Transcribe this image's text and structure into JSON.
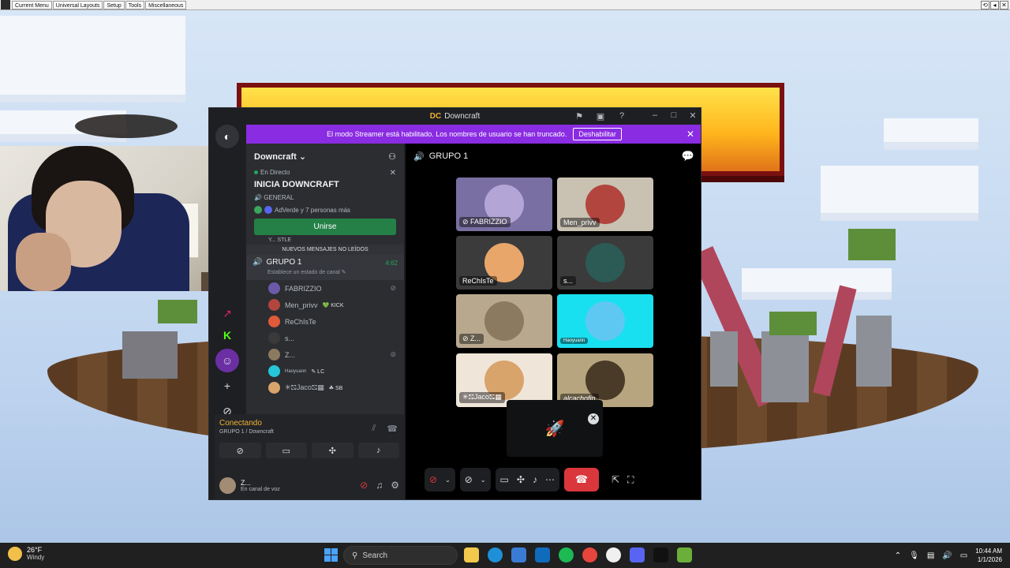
{
  "overlay_menu": {
    "items": [
      "Current Menu",
      "Universal Layouts",
      "Setup",
      "Tools",
      "Miscellaneous"
    ]
  },
  "discord": {
    "window_title": "Downcraft",
    "app_logo": "DC",
    "streamer_bar": {
      "message": "El modo Streamer está habilitado. Los nombres de usuario se han truncado.",
      "disable_label": "Deshabilitar"
    },
    "server_name": "Downcraft",
    "live": {
      "label": "En Directo",
      "title": "INICIA DOWNCRAFT",
      "channel": "GENERAL",
      "people": "AdVerde y 7 personas más",
      "join_label": "Unirse"
    },
    "partial_member": "Y... STLE",
    "new_messages_label": "NUEVOS MENSAJES NO LEÍDOS",
    "voice_channel": {
      "name": "GRUPO 1",
      "timer": "4:62",
      "status": "Establece un estado de canal"
    },
    "members": [
      {
        "name": "FABRIZZIO",
        "tag": "",
        "muted": true,
        "color": "#6c5aa8"
      },
      {
        "name": "Men_privv",
        "tag": "KICK",
        "muted": false,
        "color": "#b2463f"
      },
      {
        "name": "ReChIsTe",
        "tag": "",
        "muted": false,
        "color": "#e05a3a"
      },
      {
        "name": "s...",
        "tag": "",
        "muted": false,
        "color": "#3a3a3a"
      },
      {
        "name": "Z...",
        "tag": "",
        "muted": true,
        "color": "#8c7a60"
      },
      {
        "name": "Haoyuann",
        "tag": "LC",
        "muted": false,
        "color": "#26c6da"
      },
      {
        "name": "✳⛞Jaco⛞▦",
        "tag": "SB",
        "muted": false,
        "color": "#d9a36c"
      }
    ],
    "voice_panel": {
      "status": "Conectando",
      "location": "GRUPO 1 / Downcraft"
    },
    "user": {
      "name": "Z...",
      "state": "En canal de voz"
    },
    "main_header": "GRUPO 1",
    "tiles": [
      {
        "label": "FABRIZZIO",
        "bg": "#7a6fa2",
        "av": "#b3a6d6"
      },
      {
        "label": "Men_privv",
        "bg": "#c9c2b2",
        "av": "#b2463f"
      },
      {
        "label": "ReChIsTe",
        "bg": "#3b3b3b",
        "av": "#e8a66a"
      },
      {
        "label": "s...",
        "bg": "#3b3b3b",
        "av": "#2c5a55"
      },
      {
        "label": "Z...",
        "bg": "#b8a98e",
        "av": "#8c7a60"
      },
      {
        "label": "Haoyuann",
        "bg": "#19e0f0",
        "av": "#5fc8f2"
      },
      {
        "label": "✳⛞Jaco⛞▦",
        "bg": "#efe6d9",
        "av": "#d9a36c"
      },
      {
        "label": "alcachofin",
        "bg": "#b6a57e",
        "av": "#4a3a28"
      }
    ]
  },
  "taskbar": {
    "weather_temp": "26°F",
    "weather_desc": "Windy",
    "search_label": "Search",
    "time": "10:44 AM",
    "date": "1/1/2026"
  }
}
